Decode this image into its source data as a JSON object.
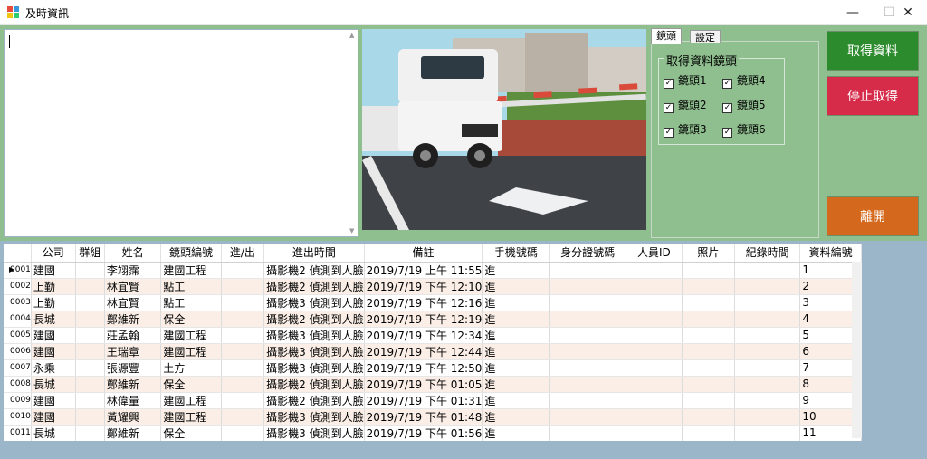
{
  "window": {
    "title": "及時資訊",
    "icon": "app-window-icon",
    "controls": {
      "minimize": "—",
      "maximize": "☐",
      "close": "✕"
    }
  },
  "textbox": {
    "value": ""
  },
  "camera": {
    "icon": "camera-feed-image"
  },
  "tabs": [
    {
      "label": "鏡頭",
      "active": true
    },
    {
      "label": "設定",
      "active": false
    }
  ],
  "camera_group": {
    "title": "取得資料鏡頭",
    "checkboxes": [
      {
        "label": "鏡頭1",
        "checked": true
      },
      {
        "label": "鏡頭2",
        "checked": true
      },
      {
        "label": "鏡頭3",
        "checked": true
      },
      {
        "label": "鏡頭4",
        "checked": true
      },
      {
        "label": "鏡頭5",
        "checked": true
      },
      {
        "label": "鏡頭6",
        "checked": true
      }
    ]
  },
  "buttons": {
    "get_data": "取得資料",
    "stop": "停止取得",
    "leave": "離開"
  },
  "colors": {
    "panel_bg": "#8fbf8f",
    "btn_get": "#2c8b2c",
    "btn_stop": "#d62c4a",
    "btn_leave": "#d4691e",
    "row_alt": "#faeee6"
  },
  "grid": {
    "columns": [
      "公司",
      "群組",
      "姓名",
      "鏡頭編號",
      "進/出",
      "進出時間",
      "備註",
      "手機號碼",
      "身分證號碼",
      "人員ID",
      "照片",
      "紀錄時間",
      "資料編號"
    ],
    "rows": [
      {
        "rh": "0001",
        "company": "建國",
        "group": "",
        "name": "李翊霈",
        "cam": "建國工程",
        "inout": "",
        "time": "攝影機2 偵測到人臉",
        "note": "2019/7/19 上午 11:55",
        "phone": "進",
        "id": "",
        "pid": "",
        "photo": "",
        "rec": "",
        "no": "1"
      },
      {
        "rh": "0002",
        "company": "上勤",
        "group": "",
        "name": "林宜賢",
        "cam": "點工",
        "inout": "",
        "time": "攝影機2 偵測到人臉",
        "note": "2019/7/19 下午 12:10",
        "phone": "進",
        "id": "",
        "pid": "",
        "photo": "",
        "rec": "",
        "no": "2"
      },
      {
        "rh": "0003",
        "company": "上勤",
        "group": "",
        "name": "林宜賢",
        "cam": "點工",
        "inout": "",
        "time": "攝影機3 偵測到人臉",
        "note": "2019/7/19 下午 12:16",
        "phone": "進",
        "id": "",
        "pid": "",
        "photo": "",
        "rec": "",
        "no": "3"
      },
      {
        "rh": "0004",
        "company": "長城",
        "group": "",
        "name": "鄭維新",
        "cam": "保全",
        "inout": "",
        "time": "攝影機2 偵測到人臉",
        "note": "2019/7/19 下午 12:19",
        "phone": "進",
        "id": "",
        "pid": "",
        "photo": "",
        "rec": "",
        "no": "4"
      },
      {
        "rh": "0005",
        "company": "建國",
        "group": "",
        "name": "莊孟翰",
        "cam": "建國工程",
        "inout": "",
        "time": "攝影機3 偵測到人臉",
        "note": "2019/7/19 下午 12:34",
        "phone": "進",
        "id": "",
        "pid": "",
        "photo": "",
        "rec": "",
        "no": "5"
      },
      {
        "rh": "0006",
        "company": "建國",
        "group": "",
        "name": "王瑞章",
        "cam": "建國工程",
        "inout": "",
        "time": "攝影機3 偵測到人臉",
        "note": "2019/7/19 下午 12:44",
        "phone": "進",
        "id": "",
        "pid": "",
        "photo": "",
        "rec": "",
        "no": "6"
      },
      {
        "rh": "0007",
        "company": "永乘",
        "group": "",
        "name": "張源豐",
        "cam": "土方",
        "inout": "",
        "time": "攝影機3 偵測到人臉",
        "note": "2019/7/19 下午 12:50",
        "phone": "進",
        "id": "",
        "pid": "",
        "photo": "",
        "rec": "",
        "no": "7"
      },
      {
        "rh": "0008",
        "company": "長城",
        "group": "",
        "name": "鄭維新",
        "cam": "保全",
        "inout": "",
        "time": "攝影機2 偵測到人臉",
        "note": "2019/7/19 下午 01:05",
        "phone": "進",
        "id": "",
        "pid": "",
        "photo": "",
        "rec": "",
        "no": "8"
      },
      {
        "rh": "0009",
        "company": "建國",
        "group": "",
        "name": "林偉量",
        "cam": "建國工程",
        "inout": "",
        "time": "攝影機2 偵測到人臉",
        "note": "2019/7/19 下午 01:31",
        "phone": "進",
        "id": "",
        "pid": "",
        "photo": "",
        "rec": "",
        "no": "9"
      },
      {
        "rh": "0010",
        "company": "建國",
        "group": "",
        "name": "黃耀興",
        "cam": "建國工程",
        "inout": "",
        "time": "攝影機3 偵測到人臉",
        "note": "2019/7/19 下午 01:48",
        "phone": "進",
        "id": "",
        "pid": "",
        "photo": "",
        "rec": "",
        "no": "10"
      },
      {
        "rh": "0011",
        "company": "長城",
        "group": "",
        "name": "鄭維新",
        "cam": "保全",
        "inout": "",
        "time": "攝影機3 偵測到人臉",
        "note": "2019/7/19 下午 01:56",
        "phone": "進",
        "id": "",
        "pid": "",
        "photo": "",
        "rec": "",
        "no": "11"
      }
    ]
  }
}
